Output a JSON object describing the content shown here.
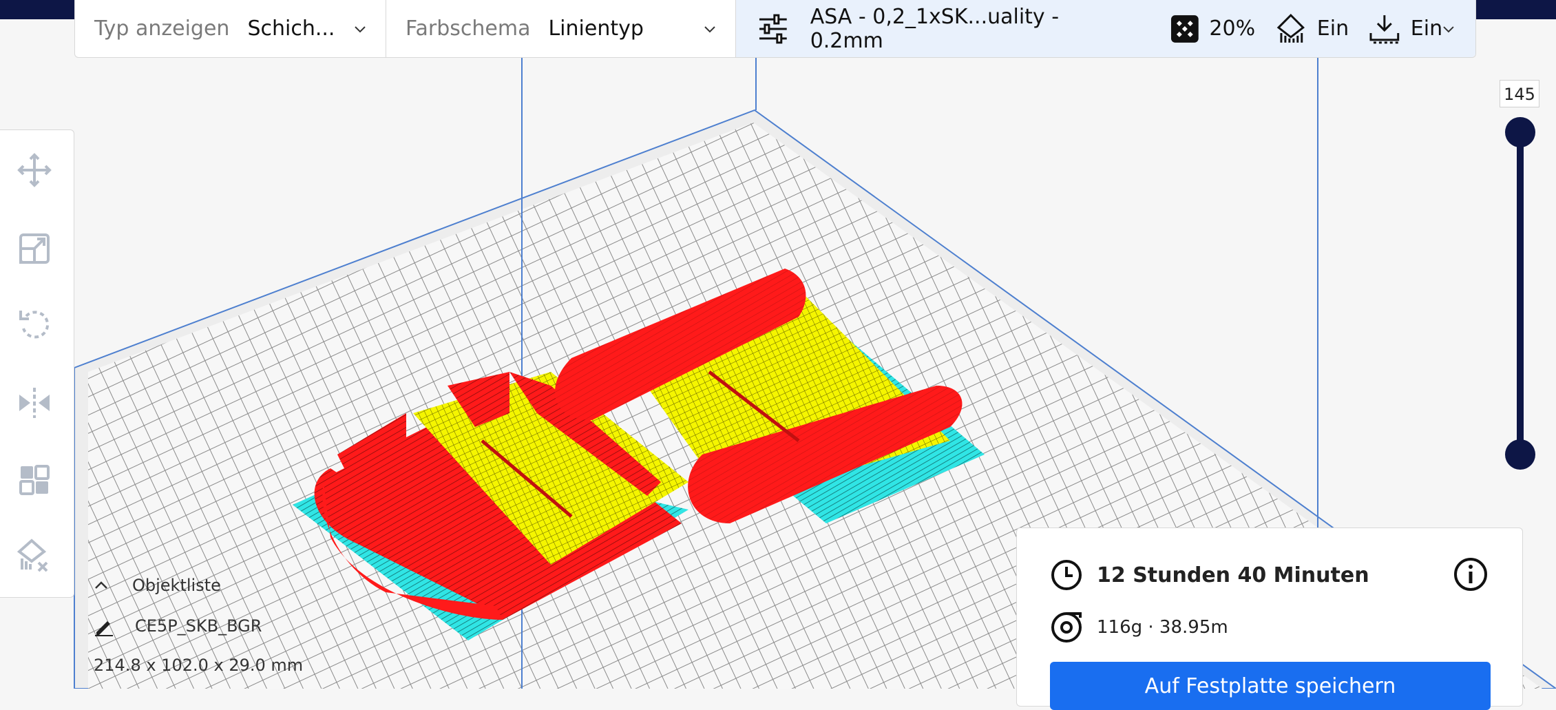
{
  "toolbar": {
    "view_type_label": "Typ anzeigen",
    "view_type_value": "Schich...",
    "color_scheme_label": "Farbschema",
    "color_scheme_value": "Linientyp",
    "profile_name": "ASA - 0,2_1xSK...uality - 0.2mm",
    "infill_percent": "20%",
    "support_value": "Ein",
    "adhesion_value": "Ein"
  },
  "tools": [
    "move-icon",
    "scale-icon",
    "rotate-icon",
    "mirror-icon",
    "per-model-settings-icon",
    "support-blocker-icon"
  ],
  "layer_slider": {
    "current_layer": "145"
  },
  "object_list": {
    "title": "Objektliste",
    "object_name": "CE5P_SKB_BGR",
    "dimensions": "214.8 x 102.0 x 29.0 mm"
  },
  "print_info": {
    "print_time": "12 Stunden 40 Minuten",
    "material": "116g · 38.95m",
    "save_button": "Auf Festplatte speichern"
  },
  "colors": {
    "accent": "#196ef0",
    "dark": "#0d1646",
    "wall": "#ff1a1a",
    "infill": "#f5f500",
    "skirt": "#30e5e5"
  }
}
